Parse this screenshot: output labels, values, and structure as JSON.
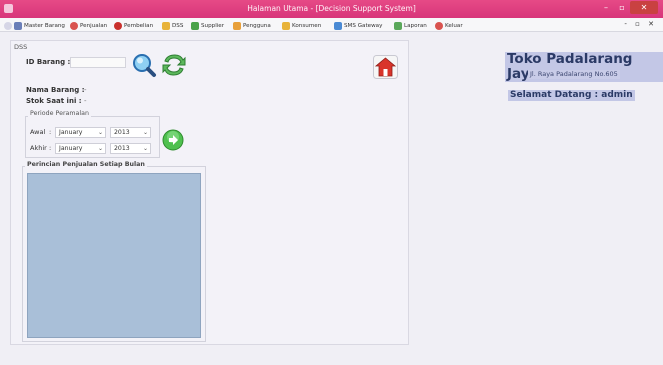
{
  "window": {
    "title": "Halaman Utama - [Decision Support System]",
    "min_glyph": "–",
    "max_glyph": "▫",
    "close_glyph": "✕"
  },
  "menu": [
    {
      "label": "Master Barang",
      "icon": "database-icon",
      "color": "#6a7fb8"
    },
    {
      "label": "Penjualan",
      "icon": "sales-icon",
      "color": "#d9534f"
    },
    {
      "label": "Pembelian",
      "icon": "purchase-icon",
      "color": "#c9302c"
    },
    {
      "label": "DSS",
      "icon": "star-icon",
      "color": "#e8b33a"
    },
    {
      "label": "Supplier",
      "icon": "truck-icon",
      "color": "#4aa34a"
    },
    {
      "label": "Pengguna",
      "icon": "user-icon",
      "color": "#e8a03a"
    },
    {
      "label": "Konsumen",
      "icon": "customer-icon",
      "color": "#e8b33a"
    },
    {
      "label": "SMS Gateway",
      "icon": "sms-icon",
      "color": "#4a8ad4"
    },
    {
      "label": "Laporan",
      "icon": "report-icon",
      "color": "#5aa85a"
    },
    {
      "label": "Keluar",
      "icon": "exit-icon",
      "color": "#d9534f"
    }
  ],
  "mdi_controls": "- ▫ ✕",
  "form": {
    "frame_title": "DSS",
    "id_barang_label": "ID Barang :",
    "nama_barang_label": "Nama Barang :",
    "nama_barang_value": "-",
    "stok_label": "Stok Saat ini :",
    "stok_value": "-",
    "periode_title": "Periode Peramalan",
    "awal_label": "Awal",
    "akhir_label": "Akhir",
    "colon": ":",
    "awal_month": "January",
    "awal_year": "2013",
    "akhir_month": "January",
    "akhir_year": "2013",
    "detail_title": "Perincian Penjualan Setiap Bulan"
  },
  "store": {
    "name": "Toko Padalarang Jaya",
    "address": "Jl. Raya Padalarang No.605",
    "welcome": "Selamat Datang : admin"
  }
}
